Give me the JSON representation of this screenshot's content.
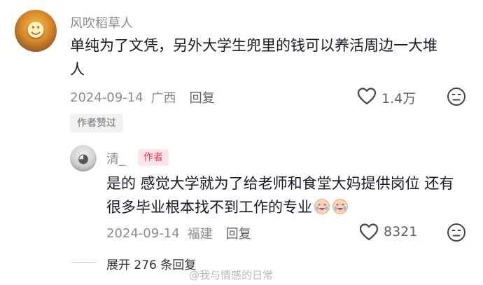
{
  "comment1": {
    "username": "风吹稻草人",
    "text_line1": "单纯为了文凭，另外大学生兜里的钱可以养活周边一大堆",
    "text_line2": "人",
    "date": "2024-09-14",
    "location": "广西",
    "reply_label": "回复",
    "likes": "1.4万",
    "author_liked_badge": "作者赞过"
  },
  "comment2": {
    "username": "清_",
    "author_tag": "作者",
    "text_line1": "是的 感觉大学就为了给老师和食堂大妈提供岗位 还有",
    "text_line2": "很多毕业根本找不到工作的专业",
    "date": "2024-09-14",
    "location": "福建",
    "reply_label": "回复",
    "likes": "8321"
  },
  "expand_replies": "展开 276 条回复",
  "watermark": "@我与情感的日常",
  "icons": {
    "like": "heart-outline-icon",
    "dislike": "unhappy-face-icon",
    "emoji": "crying-laughing-emoji-icon"
  }
}
